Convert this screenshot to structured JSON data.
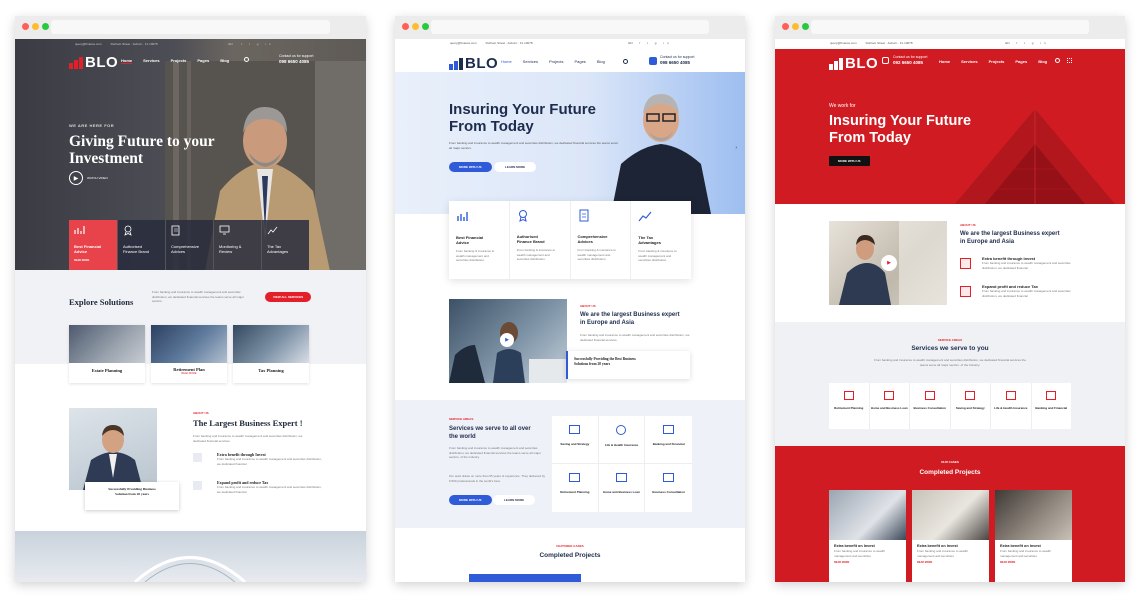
{
  "brand": {
    "name": "BLO",
    "tagline": "Finance Company"
  },
  "colors": {
    "red": "#e3202a",
    "blue": "#2f5bd9",
    "navy": "#1e2d4d",
    "dark": "#2c2d33"
  },
  "common": {
    "email": "query@finance.com",
    "address": "Dorham Street · Auburn · FL 10078",
    "language": "EN",
    "support_label": "Contact us for support",
    "phone": "098 6650 4085",
    "phone_alt": "092 6650 4085",
    "nav": [
      "Home",
      "Services",
      "Projects",
      "Pages",
      "Blog"
    ],
    "social": [
      "f",
      "t",
      "g+",
      "in"
    ]
  },
  "left": {
    "eyebrow": "WE ARE HERE FOR",
    "hero_title_l1": "Giving Future to your",
    "hero_title_l2": "Investment",
    "play_label": "WATCH VIDEO",
    "features": [
      {
        "icon": "chart-icon",
        "t1": "Best Financial",
        "t2": "Advice",
        "more": "READ MORE"
      },
      {
        "icon": "award-icon",
        "t1": "Authorised",
        "t2": "Finance Brand"
      },
      {
        "icon": "document-icon",
        "t1": "Comprehensive",
        "t2": "Advices"
      },
      {
        "icon": "monitor-icon",
        "t1": "Monitoring &",
        "t2": "Review"
      },
      {
        "icon": "growth-icon",
        "t1": "The Tax",
        "t2": "Advantages"
      }
    ],
    "explore_title": "Explore Solutions",
    "explore_text": "From banking and insurance to wealth management and securities distribution, we dedicated financial services the teams serve all major sectors.",
    "explore_button": "VIEW ALL SERVICES",
    "solutions": [
      {
        "label": "Estate Planning"
      },
      {
        "label": "Retirement Plan",
        "more": "READ MORE"
      },
      {
        "label": "Tax Planning"
      }
    ],
    "about_eyebrow": "ABOUT US",
    "about_title": "The Largest Business Expert !",
    "about_text": "From banking and insurance to wealth management and securities distribution, we dedicated financial services.",
    "about_items": [
      {
        "title": "Extra benefit through Invest",
        "text": "From banking and insurance to wealth management and securities distribution, we dedicated financial"
      },
      {
        "title": "Expand profit and reduce Tax",
        "text": "From banking and insurance to wealth management and securities distribution, we dedicated financial"
      }
    ],
    "badge_l1": "Successfully Providing Business",
    "badge_l2": "Solution from 20 years"
  },
  "middle": {
    "hero_title_l1": "Insuring Your Future",
    "hero_title_l2": "From Today",
    "hero_text": "From banking and insurance to wealth management and securities distribution, we dedicated financial services the teams serve all major sectors.",
    "btn_primary": "MORE WITH US",
    "btn_secondary": "LEARN MORE",
    "features": [
      {
        "icon": "chart-icon",
        "t1": "Best Financial",
        "t2": "Advice"
      },
      {
        "icon": "award-icon",
        "t1": "Authorised",
        "t2": "Finance Brand"
      },
      {
        "icon": "document-icon",
        "t1": "Comprehensive",
        "t2": "Advices"
      },
      {
        "icon": "growth-icon",
        "t1": "The Tax",
        "t2": "Advantages"
      }
    ],
    "feature_text": "From banking & insurance to wealth management and securities distribution.",
    "about_eyebrow": "ABOUT US",
    "about_title_l1": "We are the largest Business expert",
    "about_title_l2": "in Europe and Asia",
    "about_text": "From banking and insurance to wealth management and securities distribution, we dedicated financial services.",
    "badge_l1": "Successfully Providing the Best Business",
    "badge_l2": "Solutions from 20 years",
    "services_eyebrow": "SERVICE AREAS",
    "services_title_l1": "Services we serve to all over",
    "services_title_l2": "the world",
    "services_text": "From banking and insurance to wealth management and securities distribution, we dedicated financial services the teams serve all major sectors. of the industry.",
    "services_text2": "Our work draws on more than 65 years of experience. They delivered by 6,500 professionals in the world's best.",
    "services": [
      "Saving and Strategy",
      "Life & Health Insurance",
      "Banking and Financial",
      "Retirement Planning",
      "Home and Business Loan",
      "Business Consultation"
    ],
    "cases_eyebrow": "FEATURED CASES",
    "cases_title": "Completed Projects"
  },
  "right": {
    "eyebrow": "We work for",
    "hero_title_l1": "Insuring Your Future",
    "hero_title_l2": "From Today",
    "hero_button": "MORE WITH US",
    "about_eyebrow": "ABOUT US",
    "about_title_l1": "We are the largest Business expert",
    "about_title_l2": "in Europe and Asia",
    "about_items": [
      {
        "title": "Extra benefit through Invest",
        "text": "From banking and insurance to wealth management and securities distribution, we dedicated financial"
      },
      {
        "title": "Expand profit and reduce Tax",
        "text": "From banking and insurance to wealth management and securities distribution, we dedicated financial"
      }
    ],
    "services_eyebrow": "SERVICE AREAS",
    "services_title": "Services we serve to you",
    "services_text": "From banking and insurance to wealth management and securities distribution, we dedicated financial services the teams serve all major sectors. of the industry.",
    "services": [
      "Retirement Planning",
      "Home and Business Loan",
      "Business Consultation",
      "Saving and Strategy",
      "Life & Health Insurance",
      "Banking and Financial"
    ],
    "cases_eyebrow": "OUR CASES",
    "cases_title": "Completed Projects",
    "cases": [
      {
        "title": "Extra benefit on Invest",
        "text": "From banking and insurance to wealth management and securities",
        "more": "READ MORE"
      },
      {
        "title": "Extra benefit on Invest",
        "text": "From banking and insurance to wealth management and securities",
        "more": "READ MORE"
      },
      {
        "title": "Extra benefit on Invest",
        "text": "From banking and insurance to wealth management and securities",
        "more": "READ MORE"
      }
    ]
  }
}
